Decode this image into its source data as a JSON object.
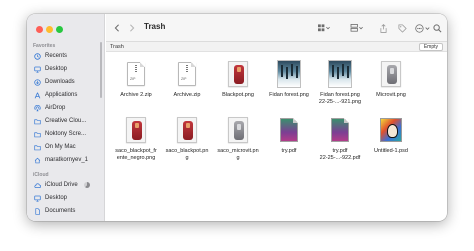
{
  "window": {
    "title": "Trash"
  },
  "sidebar": {
    "favorites_header": "Favorites",
    "favorites": [
      {
        "label": "Recents",
        "icon": "clock-icon"
      },
      {
        "label": "Desktop",
        "icon": "desktop-icon"
      },
      {
        "label": "Downloads",
        "icon": "download-icon"
      },
      {
        "label": "Applications",
        "icon": "applications-icon"
      },
      {
        "label": "AirDrop",
        "icon": "airdrop-icon"
      },
      {
        "label": "Creative Clou...",
        "icon": "folder-icon"
      },
      {
        "label": "Noktony Scre...",
        "icon": "folder-icon"
      },
      {
        "label": "On My Mac",
        "icon": "folder-icon"
      },
      {
        "label": "maratkornyev_1",
        "icon": "home-icon"
      }
    ],
    "icloud_header": "iCloud",
    "icloud": [
      {
        "label": "iCloud Drive",
        "icon": "cloud-icon"
      },
      {
        "label": "Desktop",
        "icon": "desktop-icon"
      },
      {
        "label": "Documents",
        "icon": "document-icon"
      }
    ]
  },
  "pathbar": {
    "label": "Trash",
    "empty_button": "Empty"
  },
  "files": [
    {
      "name_lines": [
        "Archive 2.zip"
      ],
      "kind": "zip"
    },
    {
      "name_lines": [
        "Archive.zip"
      ],
      "kind": "zip"
    },
    {
      "name_lines": [
        "Blackpot.png"
      ],
      "kind": "pod-red"
    },
    {
      "name_lines": [
        "Fidan forest.png"
      ],
      "kind": "forest"
    },
    {
      "name_lines": [
        "Fidan forest.png",
        "22-25-...-921.png"
      ],
      "kind": "forest"
    },
    {
      "name_lines": [
        "Microvit.png"
      ],
      "kind": "pod-gray"
    },
    {
      "name_lines": [
        "saco_blackpot_fr",
        "ente_negro.png"
      ],
      "kind": "pod-red"
    },
    {
      "name_lines": [
        "saco_blackpot.pn",
        "g"
      ],
      "kind": "pod-red"
    },
    {
      "name_lines": [
        "saco_microvit.pn",
        "g"
      ],
      "kind": "pod-gray"
    },
    {
      "name_lines": [
        "try.pdf"
      ],
      "kind": "pdf"
    },
    {
      "name_lines": [
        "try.pdf",
        "22-25-...-922.pdf"
      ],
      "kind": "pdf"
    },
    {
      "name_lines": [
        "Untitled-1.psd"
      ],
      "kind": "psd"
    }
  ],
  "toolbar": {
    "back_icon": "chevron-left-icon",
    "forward_icon": "chevron-right-icon",
    "view_icon": "icon-grid-view-icon",
    "group_icon": "group-by-icon",
    "share_icon": "share-icon",
    "tag_icon": "tag-icon",
    "more_icon": "ellipsis-circle-icon",
    "search_icon": "search-icon"
  },
  "colors": {
    "accent": "#3a7bd5",
    "sidebar_bg": "#e9e9ec",
    "close": "#fe5f57",
    "minimize": "#febc2e",
    "zoom": "#28c840"
  }
}
